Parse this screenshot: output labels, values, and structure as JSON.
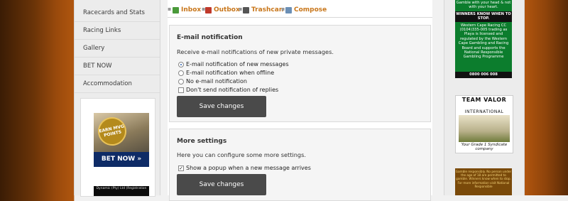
{
  "sidebar": {
    "items": [
      {
        "label": "Racecards and Stats"
      },
      {
        "label": "Racing Links"
      },
      {
        "label": "Gallery"
      },
      {
        "label": "BET NOW"
      },
      {
        "label": "Accommodation"
      }
    ],
    "ad": {
      "badge": "EARN MVG POINTS",
      "cta": "BET NOW »",
      "footer": "Dynamic (Pty) Ltd (Registration"
    }
  },
  "tabs": [
    {
      "label": "Inbox"
    },
    {
      "label": "Outbox"
    },
    {
      "label": "Trashcan"
    },
    {
      "label": "Compose"
    }
  ],
  "email_panel": {
    "title": "E-mail notification",
    "description": "Receive e-mail notifications of new private messages.",
    "options": [
      {
        "label": "E-mail notification of new messages",
        "checked": true
      },
      {
        "label": "E-mail notification when offline",
        "checked": false
      },
      {
        "label": "No e-mail notification",
        "checked": false
      }
    ],
    "checkbox": {
      "label": "Don't send notification of replies",
      "checked": false
    },
    "button": "Save changes"
  },
  "more_panel": {
    "title": "More settings",
    "description": "Here you can configure some more settings.",
    "checkbox": {
      "label": "Show a popup when a new message arrives",
      "checked": true
    },
    "button": "Save changes"
  },
  "right_ads": {
    "green": {
      "top": "Gamble with your head & not with your heart.",
      "mid": "WINNERS KNOW WHEN TO STOP.",
      "body": "Western Cape Racing CC (0104)335-005 trading as Playa is licensed and regulated by the Western Cape Gambling and Racing Board and supports the National Responsible Gambling Programme",
      "phone": "0800 006 008"
    },
    "teamvalor": {
      "title": "TEAM VALOR",
      "subtitle": "INTERNATIONAL",
      "caption": "Your Grade 1 Syndicate company"
    },
    "orange": {
      "text": "Gamble responsibly. No person under the age of 18 are permitted to gamble. Winners know when to stop. For more information visit National Responsible"
    }
  },
  "colors": {
    "tab_text": "#c8761a",
    "button_bg": "#4a4a4a",
    "green_ad": "#0c7d2d"
  }
}
